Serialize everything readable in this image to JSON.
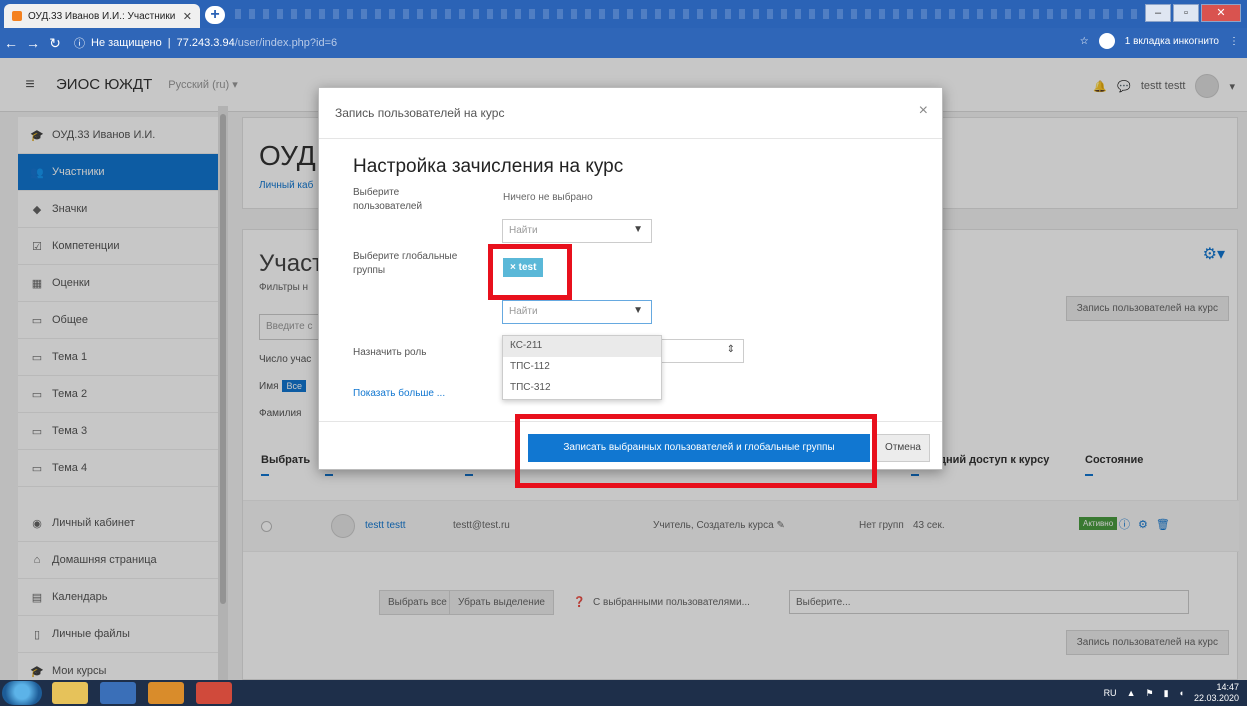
{
  "browser": {
    "tab_title": "ОУД.33 Иванов И.И.: Участники",
    "address_info": "Не защищено",
    "address_host": "77.243.3.94",
    "address_path": "/user/index.php?id=6",
    "incognito_label": "1 вкладка инкогнито"
  },
  "navbar": {
    "brand": "ЭИОС ЮЖДТ",
    "language": "Русский (ru) ▾",
    "user_name": "testt testt"
  },
  "sidebar": {
    "items": [
      {
        "label": "ОУД.33 Иванов И.И.",
        "icon": "graduation-cap-icon",
        "glyph": "🎓"
      },
      {
        "label": "Участники",
        "icon": "users-icon",
        "glyph": "👥"
      },
      {
        "label": "Значки",
        "icon": "badge-icon",
        "glyph": "◆"
      },
      {
        "label": "Компетенции",
        "icon": "checkbox-icon",
        "glyph": "☑"
      },
      {
        "label": "Оценки",
        "icon": "table-icon",
        "glyph": "▦"
      },
      {
        "label": "Общее",
        "icon": "folder-icon",
        "glyph": "▭"
      },
      {
        "label": "Тема 1",
        "icon": "folder-icon",
        "glyph": "▭"
      },
      {
        "label": "Тема 2",
        "icon": "folder-icon",
        "glyph": "▭"
      },
      {
        "label": "Тема 3",
        "icon": "folder-icon",
        "glyph": "▭"
      },
      {
        "label": "Тема 4",
        "icon": "folder-icon",
        "glyph": "▭"
      },
      {
        "label": "Личный кабинет",
        "icon": "dashboard-icon",
        "glyph": "◉"
      },
      {
        "label": "Домашняя страница",
        "icon": "home-icon",
        "glyph": "⌂"
      },
      {
        "label": "Календарь",
        "icon": "calendar-icon",
        "glyph": "▤"
      },
      {
        "label": "Личные файлы",
        "icon": "file-icon",
        "glyph": "▯"
      },
      {
        "label": "Мои курсы",
        "icon": "graduation-cap-icon",
        "glyph": "🎓"
      }
    ]
  },
  "main": {
    "course_title": "ОУД.",
    "breadcrumb": "Личный каб",
    "participants_title": "Участн",
    "filter_label": "Фильтры н",
    "search_placeholder": "Введите с",
    "enrol_button": "Запись пользователей на курс",
    "count_label": "Число учас",
    "name_label": "Имя",
    "name_chip": "Все",
    "surname_label": "Фамилия",
    "table": {
      "col_select": "Выбрать",
      "col_last_access": "ледний доступ к курсу",
      "col_status": "Состояние",
      "row": {
        "name": "testt testt",
        "email": "testt@test.ru",
        "roles": "Учитель, Создатель курса ✎",
        "groups": "Нет групп",
        "last_access": "43 сек.",
        "status": "Активно"
      }
    },
    "bulk": {
      "select_all": "Выбрать все",
      "deselect": "Убрать выделение",
      "with_selected": "С выбранными пользователями...",
      "choose": "Выберите..."
    }
  },
  "modal": {
    "title": "Запись пользователей на курс",
    "heading": "Настройка зачисления на курс",
    "select_users_label": "Выберите пользователей",
    "nothing_selected": "Ничего не выбрано",
    "find_placeholder": "Найти",
    "global_groups_label": "Выберите глобальные группы",
    "selected_tag": "× test",
    "assign_role_label": "Назначить роль",
    "show_more": "Показать больше ...",
    "dropdown_options": [
      "КС-211",
      "ТПС-112",
      "ТПС-312"
    ],
    "submit_button": "Записать выбранных пользователей и глобальные группы",
    "cancel_button": "Отмена"
  },
  "taskbar": {
    "lang": "RU",
    "time": "14:47",
    "date": "22.03.2020"
  },
  "colors": {
    "accent": "#1177d1",
    "highlight": "#e8101c",
    "tag": "#5ab8d8"
  }
}
